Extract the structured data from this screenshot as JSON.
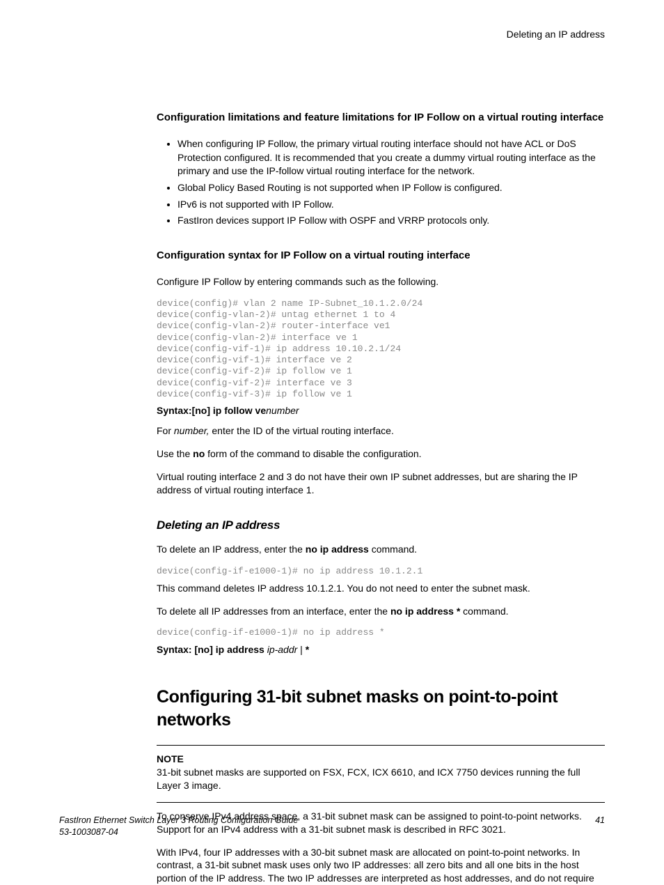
{
  "topRight": "Deleting an IP address",
  "sec1": {
    "heading": "Configuration limitations and feature limitations for IP Follow on a virtual routing interface",
    "bullets": [
      "When configuring IP Follow, the primary virtual routing interface should not have ACL or DoS Protection configured. It is recommended that you create a dummy virtual routing interface as the primary and use the IP-follow virtual routing interface for the network.",
      "Global Policy Based Routing is not supported when IP Follow is configured.",
      "IPv6 is not supported with IP Follow.",
      "FastIron devices support IP Follow with OSPF and VRRP protocols only."
    ]
  },
  "sec2": {
    "heading": "Configuration syntax for IP Follow on a virtual routing interface",
    "intro": "Configure IP Follow by entering commands such as the following.",
    "code": "device(config)# vlan 2 name IP-Subnet_10.1.2.0/24\ndevice(config-vlan-2)# untag ethernet 1 to 4\ndevice(config-vlan-2)# router-interface ve1\ndevice(config-vlan-2)# interface ve 1\ndevice(config-vif-1)# ip address 10.10.2.1/24\ndevice(config-vif-1)# interface ve 2\ndevice(config-vif-2)# ip follow ve 1\ndevice(config-vif-2)# interface ve 3\ndevice(config-vif-3)# ip follow ve 1",
    "syntax_bold1": "Syntax:[no] ip follow ve",
    "syntax_italic1": "number",
    "forText1": "For ",
    "forItalic": "number,",
    "forText2": " enter the ID of the virtual routing interface.",
    "useThe1": "Use the ",
    "useBold": "no",
    "useThe2": " form of the command to disable the configuration.",
    "sharing": "Virtual routing interface 2 and 3 do not have their own IP subnet addresses, but are sharing the IP address of virtual routing interface 1."
  },
  "sec3": {
    "heading": "Deleting an IP address",
    "intro1a": "To delete an IP address, enter the ",
    "intro1b": "no ip address",
    "intro1c": " command.",
    "code1": "device(config-if-e1000-1)# no ip address 10.1.2.1",
    "explain1": "This command deletes IP address 10.1.2.1. You do not need to enter the subnet mask.",
    "intro2a": "To delete all IP addresses from an interface, enter the ",
    "intro2b": "no ip address *",
    "intro2c": " command.",
    "code2": "device(config-if-e1000-1)# no ip address *",
    "syntax2a": "Syntax: [no] ip address ",
    "syntax2b": "ip-addr",
    "syntax2c": " | ",
    "syntax2d": "*"
  },
  "sec4": {
    "heading": "Configuring 31-bit subnet masks on point-to-point networks",
    "noteLabel": "NOTE",
    "noteBody": "31-bit subnet masks are supported on FSX, FCX, ICX 6610, and ICX 7750 devices running the full Layer 3 image.",
    "para1": "To conserve IPv4 address space, a 31-bit subnet mask can be assigned to point-to-point networks. Support for an IPv4 address with a 31-bit subnet mask is described in RFC 3021.",
    "para2": "With IPv4, four IP addresses with a 30-bit subnet mask are allocated on point-to-point networks. In contrast, a 31-bit subnet mask uses only two IP addresses: all zero bits and all one bits in the host portion of the IP address. The two IP addresses are interpreted as host addresses, and do not require"
  },
  "footer": {
    "title": "FastIron Ethernet Switch Layer 3 Routing Configuration Guide",
    "doc": "53-1003087-04",
    "page": "41"
  }
}
